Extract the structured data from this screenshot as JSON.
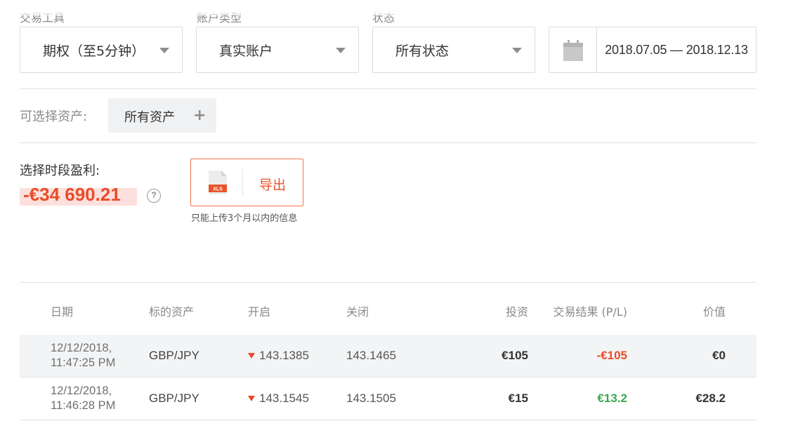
{
  "filters": {
    "instrument": {
      "label": "交易工具",
      "value": "期权（至5分钟）"
    },
    "account": {
      "label": "账户类型",
      "value": "真实账户"
    },
    "status": {
      "label": "状态",
      "value": "所有状态"
    },
    "date_range": {
      "value": "2018.07.05 — 2018.12.13"
    }
  },
  "assets": {
    "label": "可选择资产:",
    "chip": "所有资产",
    "chip_icon": "plus-icon"
  },
  "profit": {
    "label": "选择时段盈利:",
    "value": "-€34 690.21",
    "help_icon": "question-icon"
  },
  "export": {
    "label": "导出",
    "icon_text": "XLS",
    "note": "只能上传3个月以内的信息"
  },
  "table": {
    "columns": {
      "date": "日期",
      "asset": "标的资产",
      "open": "开启",
      "close": "关闭",
      "invest": "投资",
      "result": "交易结果 (P/L)",
      "value": "价值"
    },
    "rows": [
      {
        "date_line1": "12/12/2018,",
        "date_line2": "11:47:25 PM",
        "asset": "GBP/JPY",
        "direction": "down",
        "open": "143.1385",
        "close": "143.1465",
        "invest": "€105",
        "result": "-€105",
        "result_color": "#e84d2a",
        "value": "€0"
      },
      {
        "date_line1": "12/12/2018,",
        "date_line2": "11:46:28 PM",
        "asset": "GBP/JPY",
        "direction": "down",
        "open": "143.1545",
        "close": "143.1505",
        "invest": "€15",
        "result": "€13.2",
        "result_color": "#3aa84f",
        "value": "€28.2"
      }
    ]
  },
  "colors": {
    "accent": "#e84d2a",
    "positive": "#3aa84f",
    "border": "#dcdcdc"
  }
}
